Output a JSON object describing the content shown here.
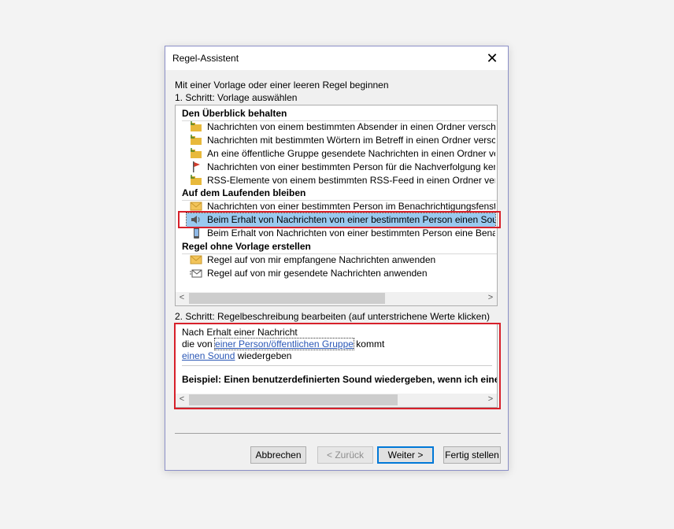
{
  "dialog": {
    "title": "Regel-Assistent",
    "intro": "Mit einer Vorlage oder einer leeren Regel beginnen",
    "step1_label": "1. Schritt: Vorlage auswählen",
    "step2_label": "2. Schritt: Regelbeschreibung bearbeiten (auf unterstrichene Werte klicken)"
  },
  "templates": {
    "sections": [
      {
        "title": "Den Überblick behalten",
        "items": [
          {
            "icon": "folder-move-icon",
            "label": "Nachrichten von einem bestimmten Absender in einen Ordner verschieben"
          },
          {
            "icon": "folder-move-icon",
            "label": "Nachrichten mit bestimmten Wörtern im Betreff in einen Ordner verschieben"
          },
          {
            "icon": "folder-move-icon",
            "label": "An eine öffentliche Gruppe gesendete Nachrichten in einen Ordner verschieben"
          },
          {
            "icon": "flag-icon",
            "label": "Nachrichten von einer bestimmten Person für die Nachverfolgung kennzeichnen"
          },
          {
            "icon": "folder-move-icon",
            "label": "RSS-Elemente von einem bestimmten RSS-Feed in einen Ordner verschieben"
          }
        ]
      },
      {
        "title": "Auf dem Laufenden bleiben",
        "items": [
          {
            "icon": "envelope-icon",
            "label": "Nachrichten von einer bestimmten Person im Benachrichtigungsfenster anzeigen"
          },
          {
            "icon": "speaker-icon",
            "label": "Beim Erhalt von Nachrichten von einer bestimmten Person einen Sound wiedergeben",
            "selected": true
          },
          {
            "icon": "mobile-device-icon",
            "label": "Beim Erhalt von Nachrichten von einer bestimmten Person eine Benachrichtigung senden"
          }
        ]
      },
      {
        "title": "Regel ohne Vorlage erstellen",
        "items": [
          {
            "icon": "envelope-icon",
            "label": "Regel auf von mir empfangene Nachrichten anwenden"
          },
          {
            "icon": "sent-mail-icon",
            "label": "Regel auf von mir gesendete Nachrichten anwenden"
          }
        ]
      }
    ]
  },
  "description": {
    "line1": "Nach Erhalt einer Nachricht",
    "line2_prefix": "die von ",
    "line2_link": "einer Person/öffentlichen Gruppe",
    "line2_suffix": " kommt",
    "line3_link": "einen Sound",
    "line3_suffix": " wiedergeben",
    "example": "Beispiel: Einen benutzerdefinierten Sound wiedergeben, wenn ich eine Nachricht erhalte"
  },
  "buttons": {
    "cancel": "Abbrechen",
    "back": "< Zurück",
    "next": "Weiter >",
    "finish": "Fertig stellen"
  },
  "colors": {
    "highlight_box": "#d7202a",
    "selection": "#99c9ef",
    "link": "#2a57b6"
  }
}
